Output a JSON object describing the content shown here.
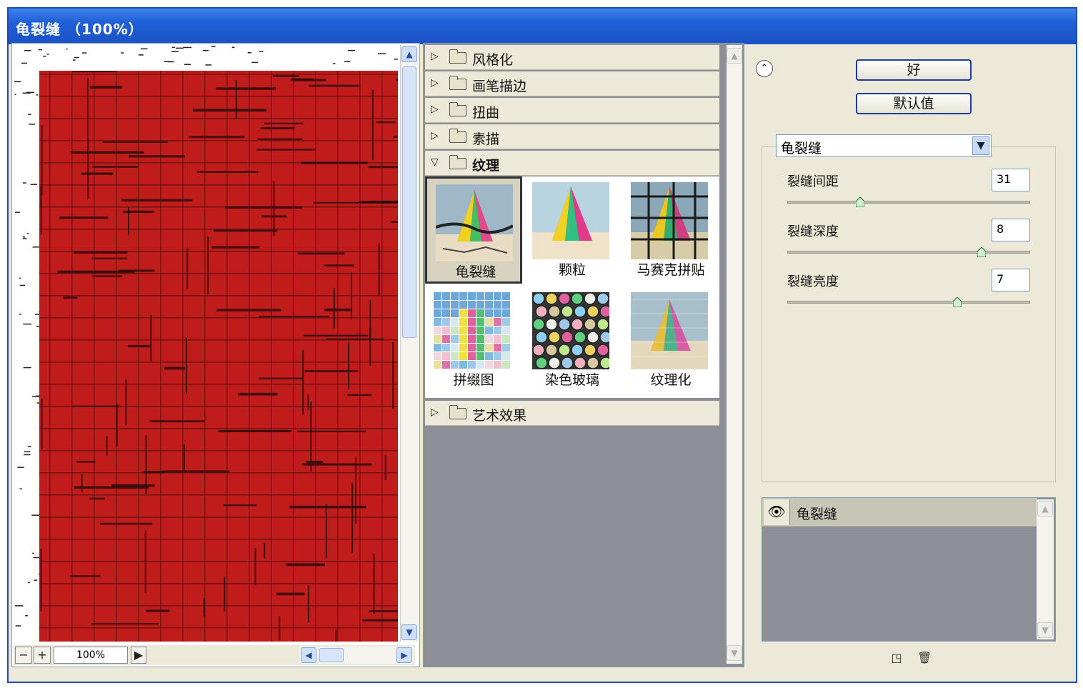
{
  "window": {
    "title": "龟裂缝 （100%）"
  },
  "preview": {
    "zoom_minus": "−",
    "zoom_plus": "+",
    "zoom_value": "100%"
  },
  "filter_categories": [
    {
      "label": "风格化",
      "expanded": false
    },
    {
      "label": "画笔描边",
      "expanded": false
    },
    {
      "label": "扭曲",
      "expanded": false
    },
    {
      "label": "素描",
      "expanded": false
    },
    {
      "label": "纹理",
      "expanded": true
    },
    {
      "label": "艺术效果",
      "expanded": false
    }
  ],
  "texture_filters": [
    {
      "label": "龟裂缝",
      "selected": true
    },
    {
      "label": "颗粒",
      "selected": false
    },
    {
      "label": "马赛克拼贴",
      "selected": false
    },
    {
      "label": "拼缀图",
      "selected": false
    },
    {
      "label": "染色玻璃",
      "selected": false
    },
    {
      "label": "纹理化",
      "selected": false
    }
  ],
  "buttons": {
    "ok": "好",
    "default": "默认值"
  },
  "selected_filter": "龟裂缝",
  "params": [
    {
      "label": "裂缝间距",
      "value": "31",
      "fraction": 0.3
    },
    {
      "label": "裂缝深度",
      "value": "8",
      "fraction": 0.8
    },
    {
      "label": "裂缝亮度",
      "value": "7",
      "fraction": 0.7
    }
  ],
  "layers": [
    {
      "name": "龟裂缝"
    }
  ],
  "colors": {
    "preview_red": "#c01c1c",
    "titlebar": "#1f5fd6",
    "panel_bg": "#ece9d8",
    "layer_bg": "#8c9096"
  }
}
